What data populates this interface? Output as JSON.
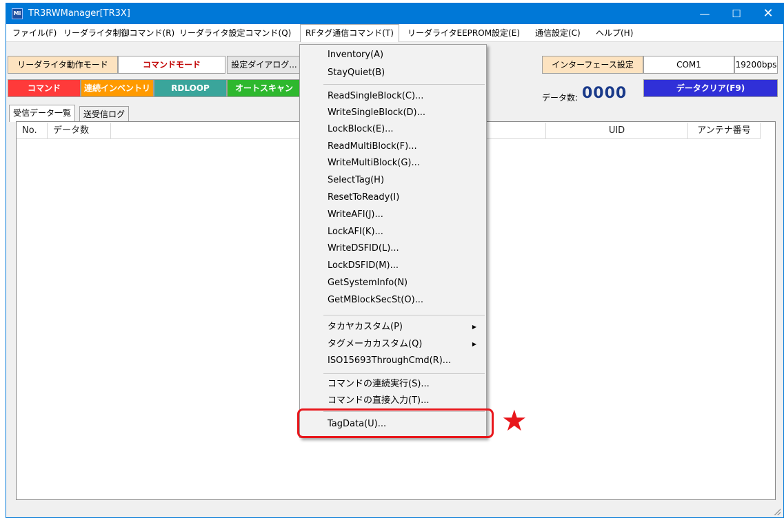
{
  "window": {
    "title": "TR3RWManager[TR3X]",
    "app_icon": "Mi",
    "minimize": "—",
    "maximize": "☐",
    "close": "✕"
  },
  "menubar": {
    "items": [
      {
        "label": "ファイル(F)"
      },
      {
        "label": "リーダライタ制御コマンド(R)"
      },
      {
        "label": "リーダライタ設定コマンド(Q)"
      },
      {
        "label": "RFタグ通信コマンド(T)"
      },
      {
        "label": "リーダライタEEPROM設定(E)"
      },
      {
        "label": "通信設定(C)"
      },
      {
        "label": "ヘルプ(H)"
      }
    ]
  },
  "toolbar": {
    "mode_label": "リーダライタ動作モード",
    "mode_value": "コマンドモード",
    "settings_dialog": "設定ダイアログ...",
    "command": "コマンド",
    "continuous_inventory": "連続インベントリ",
    "rdloop": "RDLOOP",
    "auto_scan": "オートスキャン",
    "interface_settings": "インターフェース設定",
    "com_port": "COM1",
    "baud_rate": "19200bps",
    "data_count_label": "データ数:",
    "data_count_value": "0000",
    "data_clear": "データクリア(F9)"
  },
  "tabs": [
    {
      "label": "受信データ一覧"
    },
    {
      "label": "送受信ログ"
    }
  ],
  "list": {
    "columns": [
      "No.",
      "データ数",
      "UID",
      "アンテナ番号"
    ]
  },
  "dropdown": {
    "items": [
      {
        "label": "Inventory(A)"
      },
      {
        "label": "StayQuiet(B)"
      },
      {
        "label": "ReadSingleBlock(C)..."
      },
      {
        "label": "WriteSingleBlock(D)..."
      },
      {
        "label": "LockBlock(E)..."
      },
      {
        "label": "ReadMultiBlock(F)..."
      },
      {
        "label": "WriteMultiBlock(G)..."
      },
      {
        "label": "SelectTag(H)"
      },
      {
        "label": "ResetToReady(I)"
      },
      {
        "label": "WriteAFI(J)..."
      },
      {
        "label": "LockAFI(K)..."
      },
      {
        "label": "WriteDSFID(L)..."
      },
      {
        "label": "LockDSFID(M)..."
      },
      {
        "label": "GetSystemInfo(N)"
      },
      {
        "label": "GetMBlockSecSt(O)..."
      },
      {
        "label": "タカヤカスタム(P)"
      },
      {
        "label": "タグメーカカスタム(Q)"
      },
      {
        "label": "ISO15693ThroughCmd(R)..."
      },
      {
        "label": "コマンドの連続実行(S)..."
      },
      {
        "label": "コマンドの直接入力(T)..."
      },
      {
        "label": "TagData(U)..."
      }
    ],
    "submenu_arrow": "▶"
  },
  "annotation": {
    "star": "★",
    "accent_color": "#e8161b"
  }
}
